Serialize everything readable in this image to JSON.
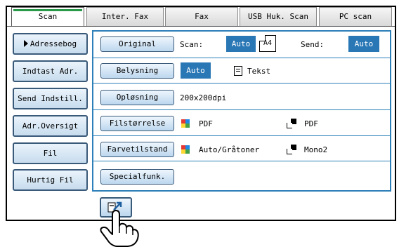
{
  "tabs": [
    "Scan",
    "Inter. Fax",
    "Fax",
    "USB Huk. Scan",
    "PC scan"
  ],
  "left_buttons": [
    "Adressebog",
    "Indtast Adr.",
    "Send Indstill.",
    "Adr.Oversigt",
    "Fil",
    "Hurtig Fil"
  ],
  "settings": {
    "original_label": "Original",
    "scan_label": "Scan:",
    "scan_value": "Auto",
    "paper": "A4",
    "send_label": "Send:",
    "send_value": "Auto",
    "belysning_label": "Belysning",
    "belysning_value": "Auto",
    "belysning_mode": "Tekst",
    "oplosning_label": "Opløsning",
    "oplosning_value": "200x200dpi",
    "filstorrelse_label": "Filstørrelse",
    "file_color_format": "PDF",
    "file_mono_format": "PDF",
    "farvetilstand_label": "Farvetilstand",
    "color_mode": "Auto/Gråtoner",
    "mono_mode": "Mono2",
    "special_label": "Specialfunk."
  },
  "colors": {
    "accent": "#2a77b6",
    "frame": "#2c7fb8",
    "tab_active_strip": "#2a9a4a"
  }
}
